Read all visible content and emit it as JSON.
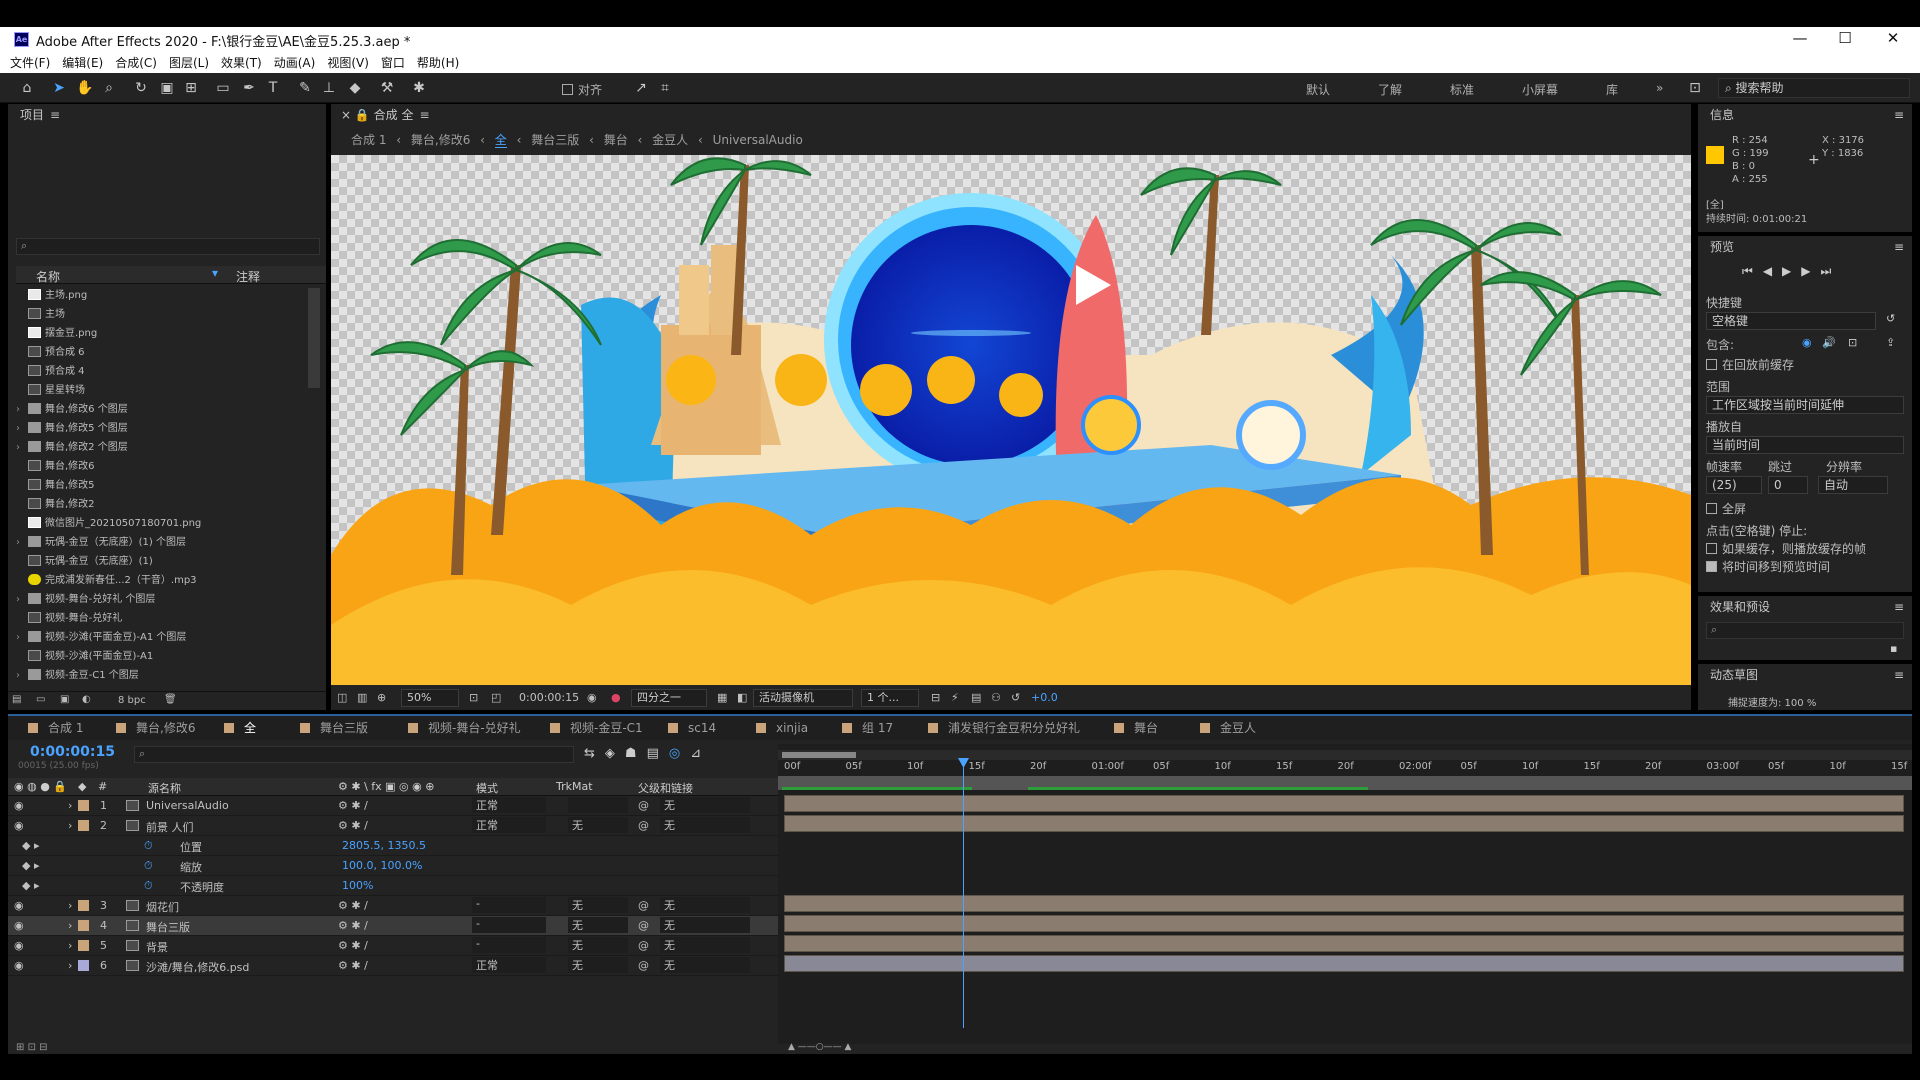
{
  "app": {
    "title": "Adobe After Effects 2020 - F:\\银行金豆\\AE\\金豆5.25.3.aep *",
    "icon": "Ae"
  },
  "menu": [
    "文件(F)",
    "编辑(E)",
    "合成(C)",
    "图层(L)",
    "效果(T)",
    "动画(A)",
    "视图(V)",
    "窗口",
    "帮助(H)"
  ],
  "toolbar": {
    "align_label": "对齐",
    "workspaces": [
      "默认",
      "了解",
      "标准",
      "小屏幕",
      "库"
    ],
    "search_help": "搜索帮助"
  },
  "project": {
    "title": "项目",
    "col_name": "名称",
    "col_comment": "注释",
    "items": [
      {
        "name": "主场.png",
        "type": "img"
      },
      {
        "name": "主场",
        "type": "comp"
      },
      {
        "name": "摆金豆.png",
        "type": "img"
      },
      {
        "name": "预合成 6",
        "type": "comp"
      },
      {
        "name": "预合成 4",
        "type": "comp"
      },
      {
        "name": "星星转场",
        "type": "comp"
      },
      {
        "name": "舞台,修改6 个图层",
        "type": "fold"
      },
      {
        "name": "舞台,修改5 个图层",
        "type": "fold"
      },
      {
        "name": "舞台,修改2 个图层",
        "type": "fold"
      },
      {
        "name": "舞台,修改6",
        "type": "comp"
      },
      {
        "name": "舞台,修改5",
        "type": "comp"
      },
      {
        "name": "舞台,修改2",
        "type": "comp"
      },
      {
        "name": "微信图片_20210507180701.png",
        "type": "img"
      },
      {
        "name": "玩偶-金豆（无底座）(1) 个图层",
        "type": "fold"
      },
      {
        "name": "玩偶-金豆（无底座）(1)",
        "type": "comp"
      },
      {
        "name": "完成浦发新春任...2（干音）.mp3",
        "type": "aud"
      },
      {
        "name": "视频-舞台-兑好礼 个图层",
        "type": "fold"
      },
      {
        "name": "视频-舞台-兑好礼",
        "type": "comp"
      },
      {
        "name": "视频-沙滩(平面金豆)-A1 个图层",
        "type": "fold"
      },
      {
        "name": "视频-沙滩(平面金豆)-A1",
        "type": "comp"
      },
      {
        "name": "视频-金豆-C1 个图层",
        "type": "fold"
      }
    ],
    "bpc": "8 bpc"
  },
  "comp_viewer": {
    "tab": "合成 全",
    "breadcrumbs": [
      "合成 1",
      "舞台,修改6",
      "全",
      "舞台三版",
      "舞台",
      "金豆人",
      "UniversalAudio"
    ],
    "zoom": "50%",
    "timecode": "0:00:00:15",
    "resolution": "四分之一",
    "camera": "活动摄像机",
    "views": "1 个...",
    "exposure": "+0.0"
  },
  "info": {
    "title": "信息",
    "r": "R : 254",
    "g": "G : 199",
    "b": "B : 0",
    "a": "A : 255",
    "x": "X : 3176",
    "y": "Y : 1836",
    "swatch": "#FEC700",
    "comp": "[全]",
    "duration": "持续时间: 0:01:00:21"
  },
  "preview": {
    "title": "预览",
    "shortcut_label": "快捷键",
    "shortcut": "空格键",
    "include": "包含:",
    "cache": "在回放前缓存",
    "range_label": "范围",
    "range": "工作区域按当前时间延伸",
    "play_from_label": "播放自",
    "play_from": "当前时间",
    "fps_label": "帧速率",
    "skip_label": "跳过",
    "res_label": "分辨率",
    "fps": "(25)",
    "skip": "0",
    "res": "自动",
    "fullscreen": "全屏",
    "stop_label": "点击(空格键) 停止:",
    "opt1": "如果缓存，则播放缓存的帧",
    "opt2": "将时间移到预览时间"
  },
  "effects": {
    "title": "效果和预设"
  },
  "motion": {
    "title": "动态草图",
    "sub": "捕捉速度为: 100 %"
  },
  "timeline": {
    "tabs": [
      "合成 1",
      "舞台,修改6",
      "全",
      "舞台三版",
      "视频-舞台-兑好礼",
      "视频-金豆-C1",
      "sc14",
      "xinjia",
      "组 17",
      "浦发银行金豆积分兑好礼",
      "舞台",
      "金豆人"
    ],
    "timecode": "0:00:00:15",
    "fps_note": "00015 (25.00 fps)",
    "headers": {
      "num": "#",
      "name": "源名称",
      "mode": "模式",
      "trkmat": "TrkMat",
      "parent": "父级和链接"
    },
    "ruler": [
      "00f",
      "05f",
      "10f",
      "15f",
      "20f",
      "01:00f",
      "05f",
      "10f",
      "15f",
      "20f",
      "02:00f",
      "05f",
      "10f",
      "15f",
      "20f",
      "03:00f",
      "05f",
      "10f",
      "15f"
    ],
    "layers": [
      {
        "num": "1",
        "name": "UniversalAudio",
        "mode": "正常",
        "trk": "",
        "parent": "无",
        "color": "#c9a47a"
      },
      {
        "num": "2",
        "name": "前景 人们",
        "mode": "正常",
        "trk": "无",
        "parent": "无",
        "color": "#c9a47a"
      },
      {
        "num": "",
        "name": "位置",
        "value": "2805.5, 1350.5"
      },
      {
        "num": "",
        "name": "缩放",
        "value": "100.0, 100.0%"
      },
      {
        "num": "",
        "name": "不透明度",
        "value": "100%"
      },
      {
        "num": "3",
        "name": "烟花们",
        "mode": "-",
        "trk": "无",
        "parent": "无",
        "color": "#c9a47a"
      },
      {
        "num": "4",
        "name": "舞台三版",
        "mode": "-",
        "trk": "无",
        "parent": "无",
        "color": "#c9a47a"
      },
      {
        "num": "5",
        "name": "背景",
        "mode": "-",
        "trk": "无",
        "parent": "无",
        "color": "#c9a47a"
      },
      {
        "num": "6",
        "name": "沙滩/舞台,修改6.psd",
        "mode": "正常",
        "trk": "无",
        "parent": "无",
        "color": "#a9a9d9"
      }
    ]
  }
}
